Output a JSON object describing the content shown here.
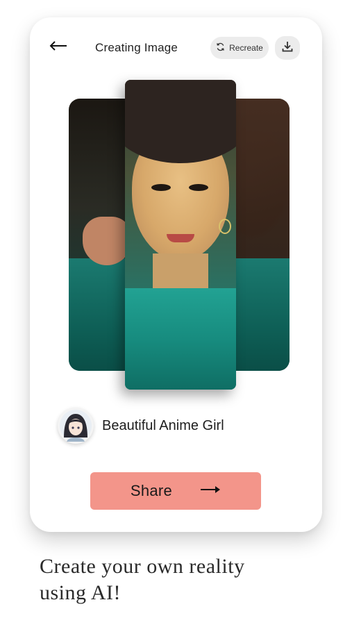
{
  "header": {
    "title": "Creating Image",
    "recreate_label": "Recreate",
    "back_icon": "arrow-left-icon",
    "recreate_icon": "refresh-icon",
    "download_icon": "download-icon"
  },
  "preview": {
    "front_image": "cartoon-styled-portrait",
    "back_image": "original-photo-portrait"
  },
  "style": {
    "name": "Beautiful Anime Girl",
    "avatar": "anime-girl-avatar"
  },
  "share": {
    "label": "Share",
    "icon": "arrow-right-icon",
    "color": "#f3958a"
  },
  "tagline": {
    "line1": "Create your own reality",
    "line2": "using AI!"
  }
}
